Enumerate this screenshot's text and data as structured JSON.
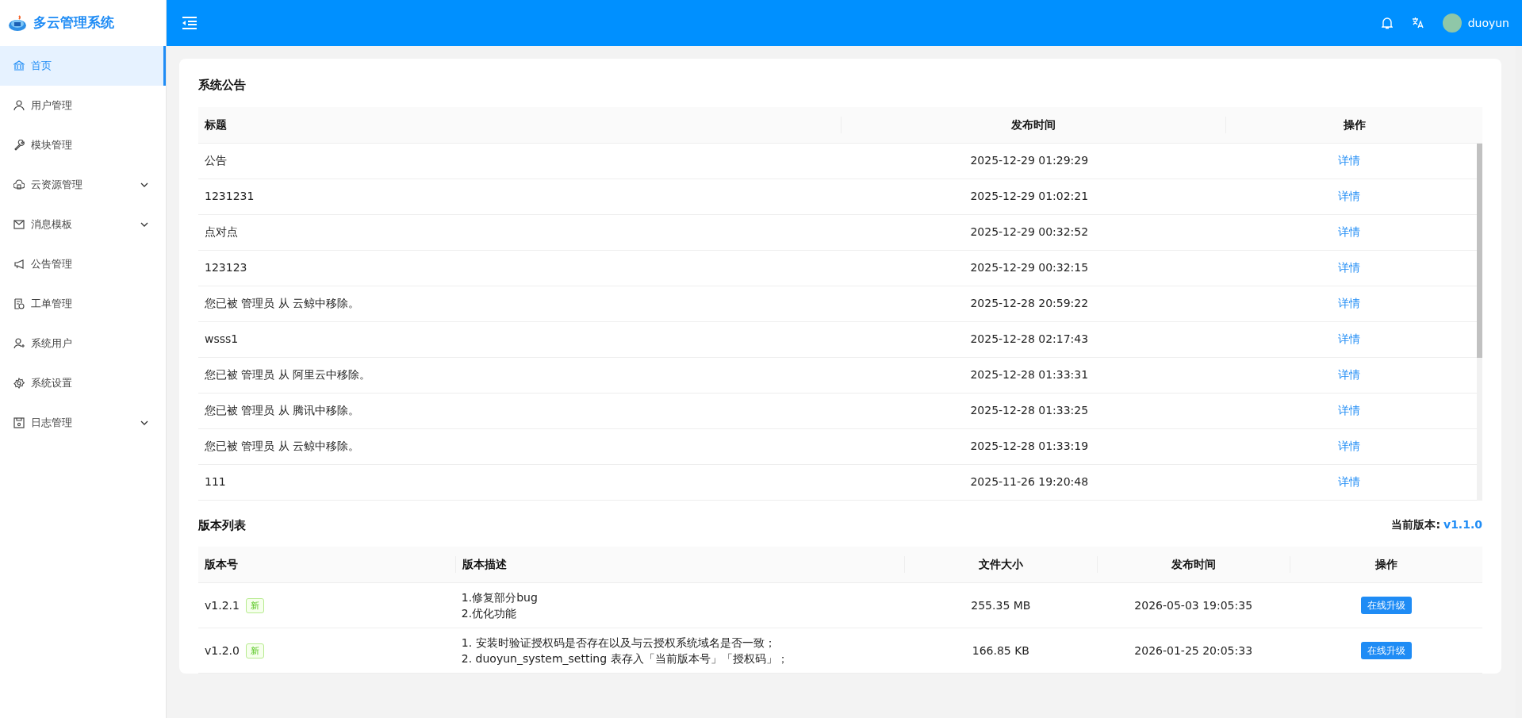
{
  "app": {
    "title": "多云管理系统"
  },
  "sidebar": {
    "items": [
      {
        "label": "首页",
        "selected": true,
        "expandable": false
      },
      {
        "label": "用户管理",
        "selected": false,
        "expandable": false
      },
      {
        "label": "模块管理",
        "selected": false,
        "expandable": false
      },
      {
        "label": "云资源管理",
        "selected": false,
        "expandable": true
      },
      {
        "label": "消息模板",
        "selected": false,
        "expandable": true
      },
      {
        "label": "公告管理",
        "selected": false,
        "expandable": false
      },
      {
        "label": "工单管理",
        "selected": false,
        "expandable": false
      },
      {
        "label": "系统用户",
        "selected": false,
        "expandable": false
      },
      {
        "label": "系统设置",
        "selected": false,
        "expandable": false
      },
      {
        "label": "日志管理",
        "selected": false,
        "expandable": true
      }
    ]
  },
  "header": {
    "user": "duoyun"
  },
  "announcements": {
    "title": "系统公告",
    "columns": [
      "标题",
      "发布时间",
      "操作"
    ],
    "rows": [
      {
        "title": "公告",
        "time": "2025-12-29 01:29:29",
        "action": "详情"
      },
      {
        "title": "1231231",
        "time": "2025-12-29 01:02:21",
        "action": "详情"
      },
      {
        "title": "点对点",
        "time": "2025-12-29 00:32:52",
        "action": "详情"
      },
      {
        "title": "123123",
        "time": "2025-12-29 00:32:15",
        "action": "详情"
      },
      {
        "title": "您已被 管理员 从 云鲸中移除。",
        "time": "2025-12-28 20:59:22",
        "action": "详情"
      },
      {
        "title": "wsss1",
        "time": "2025-12-28 02:17:43",
        "action": "详情"
      },
      {
        "title": "您已被 管理员 从 阿里云中移除。",
        "time": "2025-12-28 01:33:31",
        "action": "详情"
      },
      {
        "title": "您已被 管理员 从 腾讯中移除。",
        "time": "2025-12-28 01:33:25",
        "action": "详情"
      },
      {
        "title": "您已被 管理员 从 云鲸中移除。",
        "time": "2025-12-28 01:33:19",
        "action": "详情"
      },
      {
        "title": "111",
        "time": "2025-11-26 19:20:48",
        "action": "详情"
      }
    ]
  },
  "versions": {
    "title": "版本列表",
    "current_label": "当前版本:",
    "current_version": "v1.1.0",
    "columns": [
      "版本号",
      "版本描述",
      "文件大小",
      "发布时间",
      "操作"
    ],
    "rows": [
      {
        "version": "v1.2.1",
        "badge": "新",
        "description": [
          "1.修复部分bug",
          "2.优化功能"
        ],
        "size": "255.35 MB",
        "time": "2026-05-03 19:05:35",
        "action": "在线升级"
      },
      {
        "version": "v1.2.0",
        "badge": "新",
        "description": [
          "1. 安装时验证授权码是否存在以及与云授权系统域名是否一致；",
          "2. duoyun_system_setting 表存入「当前版本号」「授权码」；"
        ],
        "size": "166.85 KB",
        "time": "2026-01-25 20:05:33",
        "action": "在线升级"
      }
    ]
  }
}
